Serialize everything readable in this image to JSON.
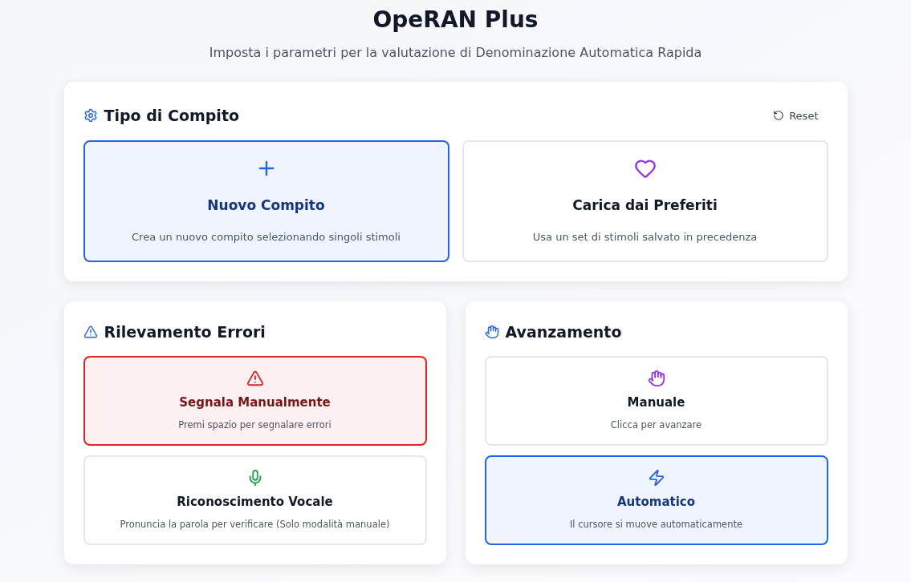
{
  "header": {
    "title": "OpeRAN Plus",
    "subtitle": "Imposta i parametri per la valutazione di Denominazione Automatica Rapida"
  },
  "task_type": {
    "title": "Tipo di Compito",
    "reset": "Reset",
    "options": [
      {
        "title": "Nuovo Compito",
        "description": "Crea un nuovo compito selezionando singoli stimoli",
        "selected": true,
        "color": "#2563eb"
      },
      {
        "title": "Carica dai Preferiti",
        "description": "Usa un set di stimoli salvato in precedenza",
        "selected": false,
        "color": "#9333ea"
      }
    ]
  },
  "error_detection": {
    "title": "Rilevamento Errori",
    "options": [
      {
        "title": "Segnala Manualmente",
        "description": "Premi spazio per segnalare errori",
        "selected": true,
        "color": "#dc2626"
      },
      {
        "title": "Riconoscimento Vocale",
        "description": "Pronuncia la parola per verificare (Solo modalità manuale)",
        "selected": false,
        "color": "#16a34a"
      }
    ]
  },
  "advancement": {
    "title": "Avanzamento",
    "options": [
      {
        "title": "Manuale",
        "description": "Clicca per avanzare",
        "selected": false,
        "color": "#9333ea"
      },
      {
        "title": "Automatico",
        "description": "Il cursore si muove automaticamente",
        "selected": true,
        "color": "#2563eb"
      }
    ]
  }
}
